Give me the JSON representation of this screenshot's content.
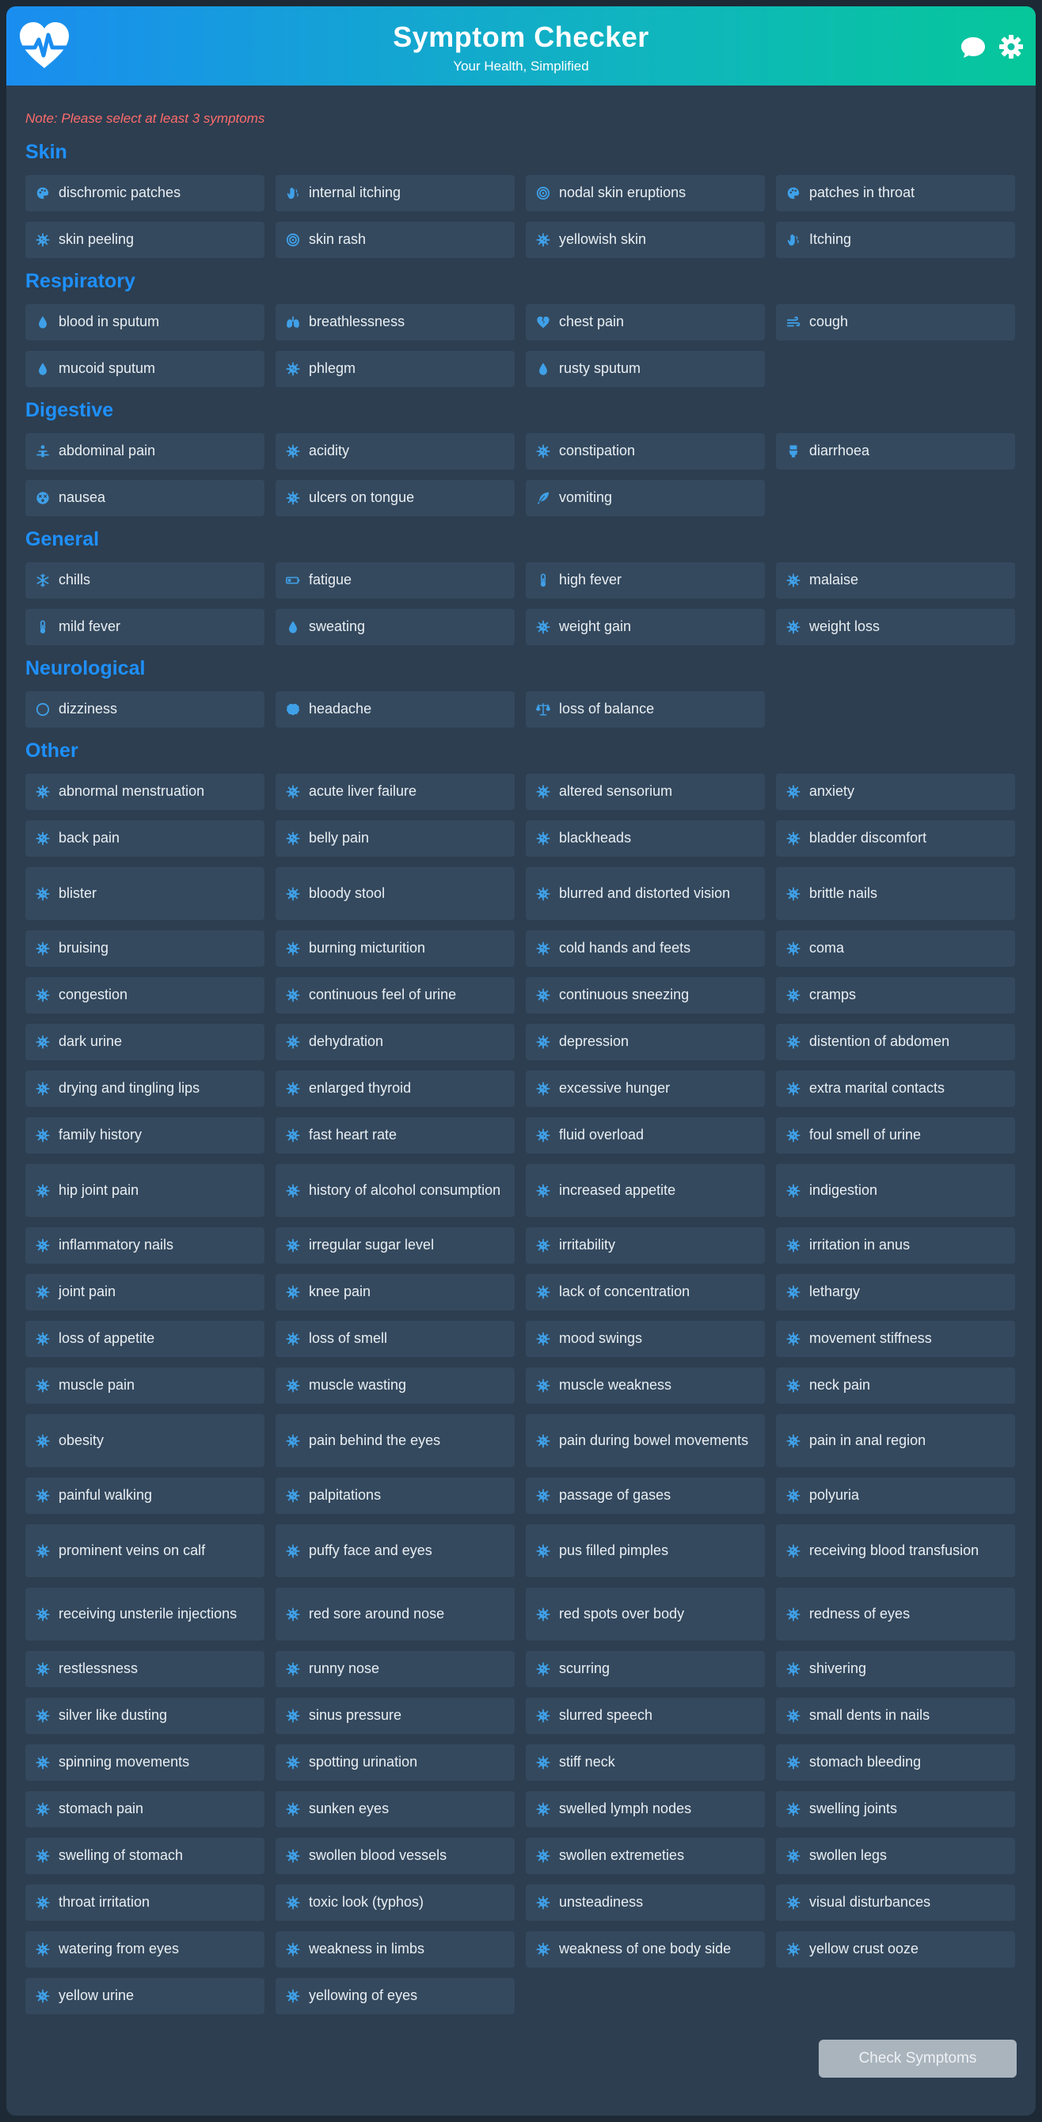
{
  "header": {
    "title": "Symptom Checker",
    "subtitle": "Your Health, Simplified",
    "icons": [
      "heartbeat-icon",
      "chat-icon",
      "gear-icon"
    ],
    "accent": "#1e90ff"
  },
  "note": "Note: Please select at least 3 symptoms",
  "sections": [
    {
      "title": "Skin",
      "items": [
        {
          "label": "dischromic patches",
          "icon": "palette"
        },
        {
          "label": "internal itching",
          "icon": "hand"
        },
        {
          "label": "nodal skin eruptions",
          "icon": "target"
        },
        {
          "label": "patches in throat",
          "icon": "palette"
        },
        {
          "label": "skin peeling",
          "icon": "virus"
        },
        {
          "label": "skin rash",
          "icon": "target"
        },
        {
          "label": "yellowish skin",
          "icon": "virus"
        },
        {
          "label": "Itching",
          "icon": "hand"
        }
      ]
    },
    {
      "title": "Respiratory",
      "items": [
        {
          "label": "blood in sputum",
          "icon": "drop"
        },
        {
          "label": "breathlessness",
          "icon": "lungs"
        },
        {
          "label": "chest pain",
          "icon": "heart-broken"
        },
        {
          "label": "cough",
          "icon": "wind"
        },
        {
          "label": "mucoid sputum",
          "icon": "drop"
        },
        {
          "label": "phlegm",
          "icon": "virus"
        },
        {
          "label": "rusty sputum",
          "icon": "drop"
        }
      ]
    },
    {
      "title": "Digestive",
      "items": [
        {
          "label": "abdominal pain",
          "icon": "person"
        },
        {
          "label": "acidity",
          "icon": "virus"
        },
        {
          "label": "constipation",
          "icon": "virus"
        },
        {
          "label": "diarrhoea",
          "icon": "toilet"
        },
        {
          "label": "nausea",
          "icon": "dizzy-face"
        },
        {
          "label": "ulcers on tongue",
          "icon": "virus"
        },
        {
          "label": "vomiting",
          "icon": "feather"
        }
      ]
    },
    {
      "title": "General",
      "items": [
        {
          "label": "chills",
          "icon": "snowflake"
        },
        {
          "label": "fatigue",
          "icon": "battery"
        },
        {
          "label": "high fever",
          "icon": "thermometer"
        },
        {
          "label": "malaise",
          "icon": "virus"
        },
        {
          "label": "mild fever",
          "icon": "thermometer"
        },
        {
          "label": "sweating",
          "icon": "drop"
        },
        {
          "label": "weight gain",
          "icon": "virus"
        },
        {
          "label": "weight loss",
          "icon": "virus"
        }
      ]
    },
    {
      "title": "Neurological",
      "items": [
        {
          "label": "dizziness",
          "icon": "circle"
        },
        {
          "label": "headache",
          "icon": "brain"
        },
        {
          "label": "loss of balance",
          "icon": "scale"
        }
      ]
    },
    {
      "title": "Other",
      "items": [
        {
          "label": "abnormal menstruation",
          "icon": "virus"
        },
        {
          "label": "acute liver failure",
          "icon": "virus"
        },
        {
          "label": "altered sensorium",
          "icon": "virus"
        },
        {
          "label": "anxiety",
          "icon": "virus"
        },
        {
          "label": "back pain",
          "icon": "virus"
        },
        {
          "label": "belly pain",
          "icon": "virus"
        },
        {
          "label": "blackheads",
          "icon": "virus"
        },
        {
          "label": "bladder discomfort",
          "icon": "virus"
        },
        {
          "label": "blister",
          "icon": "virus"
        },
        {
          "label": "bloody stool",
          "icon": "virus"
        },
        {
          "label": "blurred and distorted vision",
          "icon": "virus"
        },
        {
          "label": "brittle nails",
          "icon": "virus"
        },
        {
          "label": "bruising",
          "icon": "virus"
        },
        {
          "label": "burning micturition",
          "icon": "virus"
        },
        {
          "label": "cold hands and feets",
          "icon": "virus"
        },
        {
          "label": "coma",
          "icon": "virus"
        },
        {
          "label": "congestion",
          "icon": "virus"
        },
        {
          "label": "continuous feel of urine",
          "icon": "virus"
        },
        {
          "label": "continuous sneezing",
          "icon": "virus"
        },
        {
          "label": "cramps",
          "icon": "virus"
        },
        {
          "label": "dark urine",
          "icon": "virus"
        },
        {
          "label": "dehydration",
          "icon": "virus"
        },
        {
          "label": "depression",
          "icon": "virus"
        },
        {
          "label": "distention of abdomen",
          "icon": "virus"
        },
        {
          "label": "drying and tingling lips",
          "icon": "virus"
        },
        {
          "label": "enlarged thyroid",
          "icon": "virus"
        },
        {
          "label": "excessive hunger",
          "icon": "virus"
        },
        {
          "label": "extra marital contacts",
          "icon": "virus"
        },
        {
          "label": "family history",
          "icon": "virus"
        },
        {
          "label": "fast heart rate",
          "icon": "virus"
        },
        {
          "label": "fluid overload",
          "icon": "virus"
        },
        {
          "label": "foul smell of urine",
          "icon": "virus"
        },
        {
          "label": "hip joint pain",
          "icon": "virus"
        },
        {
          "label": "history of alcohol consumption",
          "icon": "virus"
        },
        {
          "label": "increased appetite",
          "icon": "virus"
        },
        {
          "label": "indigestion",
          "icon": "virus"
        },
        {
          "label": "inflammatory nails",
          "icon": "virus"
        },
        {
          "label": "irregular sugar level",
          "icon": "virus"
        },
        {
          "label": "irritability",
          "icon": "virus"
        },
        {
          "label": "irritation in anus",
          "icon": "virus"
        },
        {
          "label": "joint pain",
          "icon": "virus"
        },
        {
          "label": "knee pain",
          "icon": "virus"
        },
        {
          "label": "lack of concentration",
          "icon": "virus"
        },
        {
          "label": "lethargy",
          "icon": "virus"
        },
        {
          "label": "loss of appetite",
          "icon": "virus"
        },
        {
          "label": "loss of smell",
          "icon": "virus"
        },
        {
          "label": "mood swings",
          "icon": "virus"
        },
        {
          "label": "movement stiffness",
          "icon": "virus"
        },
        {
          "label": "muscle pain",
          "icon": "virus"
        },
        {
          "label": "muscle wasting",
          "icon": "virus"
        },
        {
          "label": "muscle weakness",
          "icon": "virus"
        },
        {
          "label": "neck pain",
          "icon": "virus"
        },
        {
          "label": "obesity",
          "icon": "virus"
        },
        {
          "label": "pain behind the eyes",
          "icon": "virus"
        },
        {
          "label": "pain during bowel movements",
          "icon": "virus"
        },
        {
          "label": "pain in anal region",
          "icon": "virus"
        },
        {
          "label": "painful walking",
          "icon": "virus"
        },
        {
          "label": "palpitations",
          "icon": "virus"
        },
        {
          "label": "passage of gases",
          "icon": "virus"
        },
        {
          "label": "polyuria",
          "icon": "virus"
        },
        {
          "label": "prominent veins on calf",
          "icon": "virus"
        },
        {
          "label": "puffy face and eyes",
          "icon": "virus"
        },
        {
          "label": "pus filled pimples",
          "icon": "virus"
        },
        {
          "label": "receiving blood transfusion",
          "icon": "virus"
        },
        {
          "label": "receiving unsterile injections",
          "icon": "virus"
        },
        {
          "label": "red sore around nose",
          "icon": "virus"
        },
        {
          "label": "red spots over body",
          "icon": "virus"
        },
        {
          "label": "redness of eyes",
          "icon": "virus"
        },
        {
          "label": "restlessness",
          "icon": "virus"
        },
        {
          "label": "runny nose",
          "icon": "virus"
        },
        {
          "label": "scurring",
          "icon": "virus"
        },
        {
          "label": "shivering",
          "icon": "virus"
        },
        {
          "label": "silver like dusting",
          "icon": "virus"
        },
        {
          "label": "sinus pressure",
          "icon": "virus"
        },
        {
          "label": "slurred speech",
          "icon": "virus"
        },
        {
          "label": "small dents in nails",
          "icon": "virus"
        },
        {
          "label": "spinning movements",
          "icon": "virus"
        },
        {
          "label": "spotting urination",
          "icon": "virus"
        },
        {
          "label": "stiff neck",
          "icon": "virus"
        },
        {
          "label": "stomach bleeding",
          "icon": "virus"
        },
        {
          "label": "stomach pain",
          "icon": "virus"
        },
        {
          "label": "sunken eyes",
          "icon": "virus"
        },
        {
          "label": "swelled lymph nodes",
          "icon": "virus"
        },
        {
          "label": "swelling joints",
          "icon": "virus"
        },
        {
          "label": "swelling of stomach",
          "icon": "virus"
        },
        {
          "label": "swollen blood vessels",
          "icon": "virus"
        },
        {
          "label": "swollen extremeties",
          "icon": "virus"
        },
        {
          "label": "swollen legs",
          "icon": "virus"
        },
        {
          "label": "throat irritation",
          "icon": "virus"
        },
        {
          "label": "toxic look (typhos)",
          "icon": "virus"
        },
        {
          "label": "unsteadiness",
          "icon": "virus"
        },
        {
          "label": "visual disturbances",
          "icon": "virus"
        },
        {
          "label": "watering from eyes",
          "icon": "virus"
        },
        {
          "label": "weakness in limbs",
          "icon": "virus"
        },
        {
          "label": "weakness of one body side",
          "icon": "virus"
        },
        {
          "label": "yellow crust ooze",
          "icon": "virus"
        },
        {
          "label": "yellow urine",
          "icon": "virus"
        },
        {
          "label": "yellowing of eyes",
          "icon": "virus"
        }
      ]
    }
  ],
  "check_button": "Check Symptoms",
  "colors": {
    "background": "#2c3e50",
    "chip": "#34495e",
    "note": "#ff6b6b",
    "icon": "#3fa0e8",
    "button": "#aab4bd"
  }
}
